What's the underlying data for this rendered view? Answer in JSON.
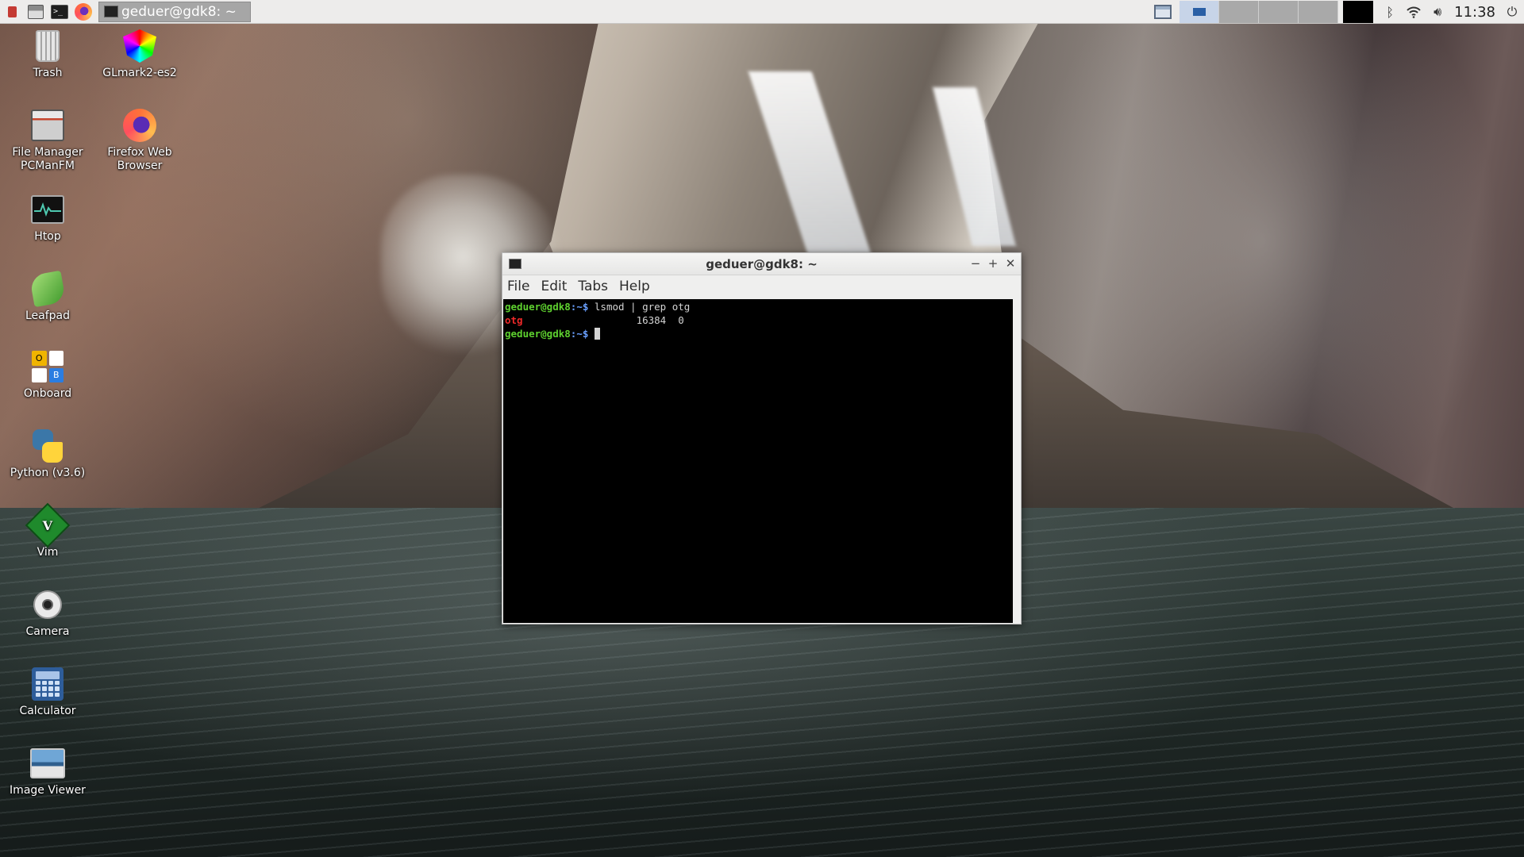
{
  "panel": {
    "taskbar_window_title": "geduer@gdk8: ~",
    "clock": "11:38",
    "launchers": [
      "start-menu-icon",
      "file-manager-icon",
      "terminal-icon",
      "firefox-icon"
    ],
    "tray_icons": [
      "bluetooth-icon",
      "wifi-icon",
      "volume-icon",
      "power-icon"
    ],
    "accent_color": "#c7d4e8"
  },
  "desktop": {
    "icons": [
      {
        "label": "Trash",
        "icon": "trash-icon"
      },
      {
        "label": "GLmark2-es2",
        "icon": "glmark-icon"
      },
      {
        "label": "File Manager\nPCManFM",
        "icon": "file-manager-icon"
      },
      {
        "label": "Firefox Web\nBrowser",
        "icon": "firefox-icon"
      },
      {
        "label": "Htop",
        "icon": "htop-icon"
      },
      {
        "label": "Leafpad",
        "icon": "leafpad-icon"
      },
      {
        "label": "Onboard",
        "icon": "onboard-icon"
      },
      {
        "label": "Python (v3.6)",
        "icon": "python-icon"
      },
      {
        "label": "Vim",
        "icon": "vim-icon"
      },
      {
        "label": "Camera",
        "icon": "camera-icon"
      },
      {
        "label": "Calculator",
        "icon": "calculator-icon"
      },
      {
        "label": "Image Viewer",
        "icon": "image-viewer-icon"
      }
    ],
    "onboard_keys": [
      "O",
      "",
      "",
      "B"
    ]
  },
  "terminal": {
    "title": "geduer@gdk8: ~",
    "menu": [
      "File",
      "Edit",
      "Tabs",
      "Help"
    ],
    "controls": {
      "minimize": "−",
      "maximize": "+",
      "close": "✕"
    },
    "lines": {
      "line1_user": "geduer@gdk8",
      "line1_path": ":~$",
      "line1_cmd": " lsmod | grep otg",
      "line2_module": "otg",
      "line2_rest": "                   16384  0",
      "line3_user": "geduer@gdk8",
      "line3_path": ":~$",
      "line3_space": " "
    }
  }
}
